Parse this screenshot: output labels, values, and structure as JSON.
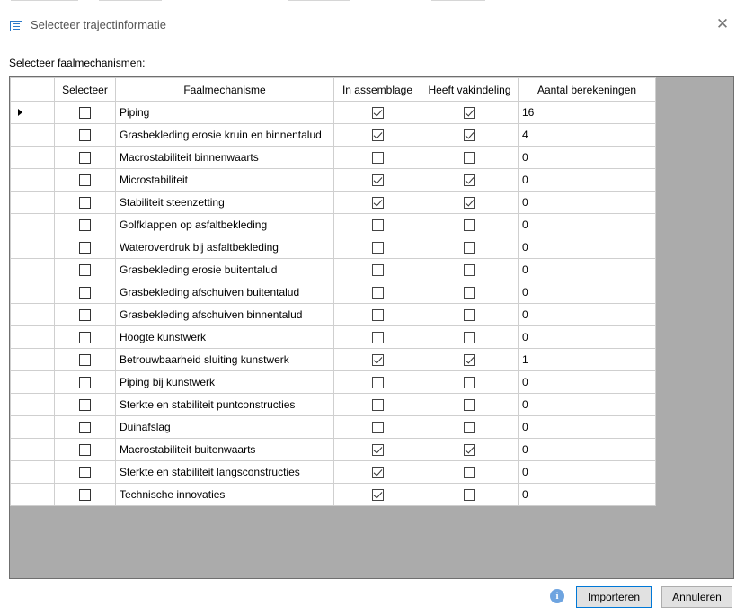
{
  "window": {
    "title": "Selecteer trajectinformatie",
    "close_label": "✕"
  },
  "section_label": "Selecteer faalmechanismen:",
  "grid": {
    "columns": [
      "Selecteer",
      "Faalmechanisme",
      "In assemblage",
      "Heeft vakindeling",
      "Aantal berekeningen"
    ],
    "rows": [
      {
        "name": "Piping",
        "selected": false,
        "in_assemblage": true,
        "vakindeling": true,
        "count": "16",
        "current": true
      },
      {
        "name": "Grasbekleding erosie kruin en binnentalud",
        "selected": false,
        "in_assemblage": true,
        "vakindeling": true,
        "count": "4"
      },
      {
        "name": "Macrostabiliteit binnenwaarts",
        "selected": false,
        "in_assemblage": false,
        "vakindeling": false,
        "count": "0"
      },
      {
        "name": "Microstabiliteit",
        "selected": false,
        "in_assemblage": true,
        "vakindeling": true,
        "count": "0"
      },
      {
        "name": "Stabiliteit steenzetting",
        "selected": false,
        "in_assemblage": true,
        "vakindeling": true,
        "count": "0"
      },
      {
        "name": "Golfklappen op asfaltbekleding",
        "selected": false,
        "in_assemblage": false,
        "vakindeling": false,
        "count": "0"
      },
      {
        "name": "Wateroverdruk bij asfaltbekleding",
        "selected": false,
        "in_assemblage": false,
        "vakindeling": false,
        "count": "0"
      },
      {
        "name": "Grasbekleding erosie buitentalud",
        "selected": false,
        "in_assemblage": false,
        "vakindeling": false,
        "count": "0"
      },
      {
        "name": "Grasbekleding afschuiven buitentalud",
        "selected": false,
        "in_assemblage": false,
        "vakindeling": false,
        "count": "0"
      },
      {
        "name": "Grasbekleding afschuiven binnentalud",
        "selected": false,
        "in_assemblage": false,
        "vakindeling": false,
        "count": "0"
      },
      {
        "name": "Hoogte kunstwerk",
        "selected": false,
        "in_assemblage": false,
        "vakindeling": false,
        "count": "0"
      },
      {
        "name": "Betrouwbaarheid sluiting kunstwerk",
        "selected": false,
        "in_assemblage": true,
        "vakindeling": true,
        "count": "1"
      },
      {
        "name": "Piping bij kunstwerk",
        "selected": false,
        "in_assemblage": false,
        "vakindeling": false,
        "count": "0"
      },
      {
        "name": "Sterkte en stabiliteit puntconstructies",
        "selected": false,
        "in_assemblage": false,
        "vakindeling": false,
        "count": "0"
      },
      {
        "name": "Duinafslag",
        "selected": false,
        "in_assemblage": false,
        "vakindeling": false,
        "count": "0"
      },
      {
        "name": "Macrostabiliteit buitenwaarts",
        "selected": false,
        "in_assemblage": true,
        "vakindeling": true,
        "count": "0"
      },
      {
        "name": "Sterkte en stabiliteit langsconstructies",
        "selected": false,
        "in_assemblage": true,
        "vakindeling": false,
        "count": "0"
      },
      {
        "name": "Technische innovaties",
        "selected": false,
        "in_assemblage": true,
        "vakindeling": false,
        "count": "0"
      }
    ]
  },
  "footer": {
    "info_icon": "info-icon",
    "import_label": "Importeren",
    "cancel_label": "Annuleren"
  },
  "colors": {
    "grid_background": "#ababab",
    "info_icon": "#6ea4e0",
    "default_button_border": "#0078d7"
  }
}
